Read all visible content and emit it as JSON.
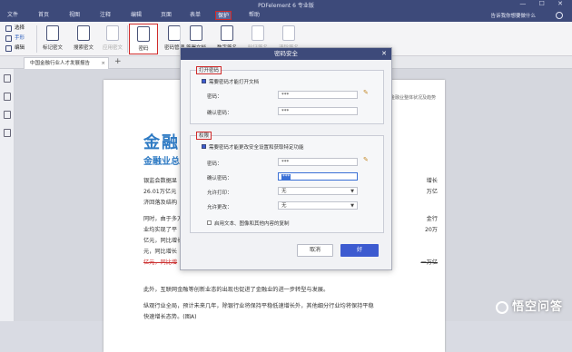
{
  "window": {
    "title": "PDFelement 6 专业版",
    "controls": "— ☐ ✕"
  },
  "menu": {
    "items": [
      "文件",
      "首页",
      "视图",
      "注释",
      "编辑",
      "页面",
      "表单",
      "保护",
      "帮助"
    ],
    "active": "保护",
    "help_link": "告诉我你想要做什么"
  },
  "tools": {
    "select": "选择",
    "hand": "手形",
    "edit": "编辑"
  },
  "ribbon": {
    "buttons": [
      "标记密文",
      "搜索密文",
      "应用密文",
      "密码",
      "密码管理",
      "签署文档",
      "数字签名",
      "验证签名",
      "清除签名"
    ]
  },
  "tabs": {
    "doc_tab": "中国金融行业人才发展报告",
    "close": "×",
    "add": "+"
  },
  "page": {
    "header_right": "金融业整体状况及趋势",
    "big_title": "金融业",
    "sub_title": "金融业总",
    "lines": [
      "银监会数据显",
      "26.01万亿元",
      "济回落及结构",
      "同时，由于多方",
      "业均实现了平",
      "亿元，同比增长",
      "元，同比增长",
      "此外，互联网金融等创新业态的出现也促进了金融业的进一步转型与发展。",
      "纵观行业全局，预计未来几年，除银行业将保持平稳低速增长外，其他细分行业均将保持平稳",
      "快速增长态势。(图A)"
    ],
    "strike_line": "亿元，同比增",
    "right_frags": [
      "增长",
      "万亿",
      "金行",
      "20万",
      "一万亿"
    ]
  },
  "dialog": {
    "title": "密码安全",
    "close": "✕",
    "open_group": {
      "label": "打开密码",
      "checkbox": "需要密码才能打开文档",
      "password_label": "密码：",
      "password_value": "***",
      "confirm_label": "确认密码：",
      "confirm_value": "***"
    },
    "perm_group": {
      "label": "权限",
      "checkbox": "需要密码才能更改安全设置和获取特定功能",
      "password_label": "密码：",
      "password_value": "***",
      "confirm_label": "确认密码：",
      "confirm_value": "***",
      "print_label": "允许打印：",
      "print_value": "无",
      "change_label": "允许更改：",
      "change_value": "无",
      "copy_checkbox": "启用文本、图像和其他内容的复制"
    },
    "cancel": "取消",
    "ok": "好"
  },
  "watermark": "悟空问答"
}
